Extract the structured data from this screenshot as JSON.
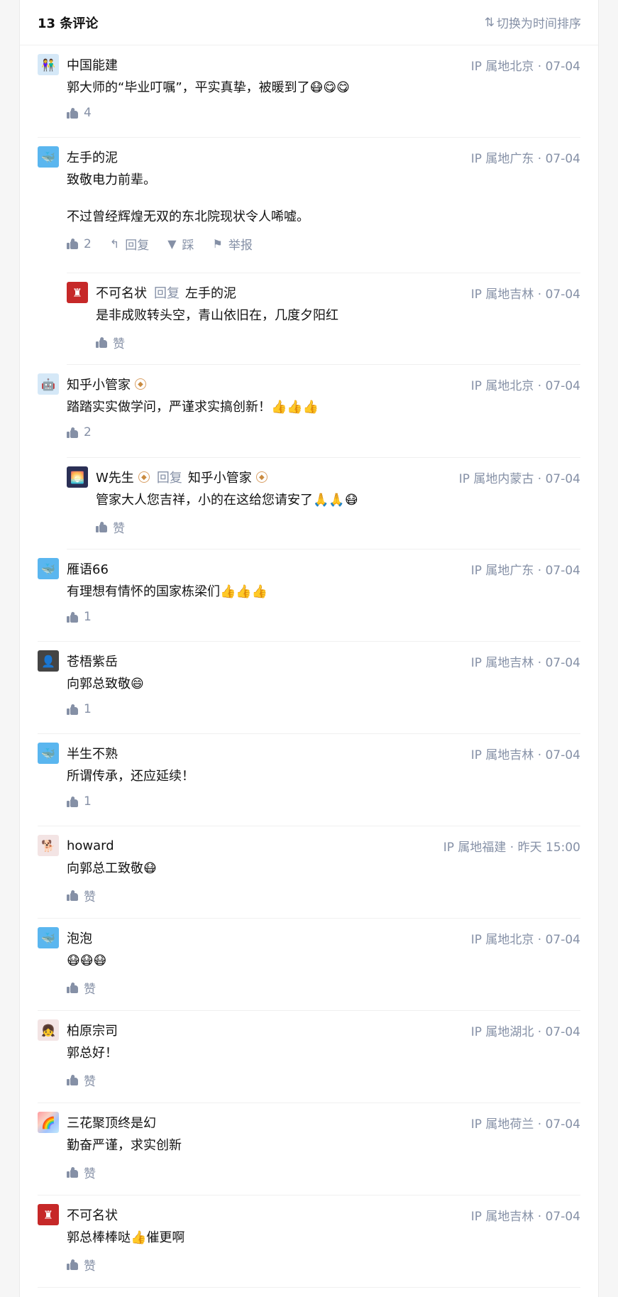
{
  "header": {
    "title": "13 条评论",
    "sort_label": "切换为时间排序",
    "sort_icon": "sort-arrows-icon"
  },
  "labels": {
    "reply": "回复",
    "dislike": "踩",
    "report": "举报",
    "like": "赞",
    "reply_to": "回复"
  },
  "colors": {
    "meta": "#8590a6",
    "text": "#121212",
    "divider": "#f0f0f0"
  },
  "comments": [
    {
      "author": "中国能建",
      "meta": "IP 属地北京 · 07-04",
      "content": "郭大师的“毕业叮嘱”，平实真挚，被暖到了😷😋😋",
      "likes": "4",
      "avatar": "couple-avatar"
    },
    {
      "author": "左手的泥",
      "meta": "IP 属地广东 · 07-04",
      "content_1": "致敬电力前辈。",
      "content_2": "不过曾经辉煌无双的东北院现状令人唏嘘。",
      "likes": "2",
      "avatar": "default-whale-avatar",
      "replies": [
        {
          "author": "不可名状",
          "reply_to": "左手的泥",
          "meta": "IP 属地吉林 · 07-04",
          "content": "是非成败转头空，青山依旧在，几度夕阳红",
          "likes": "赞"
        }
      ]
    },
    {
      "author": "知乎小管家",
      "meta": "IP 属地北京 · 07-04",
      "content": "踏踏实实做学问，严谨求实搞创新！👍👍👍",
      "likes": "2",
      "avatar": "robot-avatar",
      "replies": [
        {
          "author": "W先生",
          "reply_to": "知乎小管家",
          "meta": "IP 属地内蒙古 · 07-04",
          "content": "管家大人您吉祥，小的在这给您请安了🙏🙏😷",
          "likes": "赞"
        }
      ]
    },
    {
      "author": "雁语66",
      "meta": "IP 属地广东 · 07-04",
      "content": "有理想有情怀的国家栋梁们👍👍👍",
      "likes": "1"
    },
    {
      "author": "苍梧紫岳",
      "meta": "IP 属地吉林 · 07-04",
      "content": "向郭总致敬😄",
      "likes": "1"
    },
    {
      "author": "半生不熟",
      "meta": "IP 属地吉林 · 07-04",
      "content": "所谓传承，还应延续！",
      "likes": "1"
    },
    {
      "author": "howard",
      "meta": "IP 属地福建 · 昨天 15:00",
      "content": "向郭总工致敬😷",
      "likes": "赞"
    },
    {
      "author": "泡泡",
      "meta": "IP 属地北京 · 07-04",
      "content": "😷😷😷",
      "likes": "赞"
    },
    {
      "author": "柏原宗司",
      "meta": "IP 属地湖北 · 07-04",
      "content": "郭总好！",
      "likes": "赞"
    },
    {
      "author": "三花聚顶终是幻",
      "meta": "IP 属地荷兰 · 07-04",
      "content": "勤奋严谨，求实创新",
      "likes": "赞"
    },
    {
      "author": "不可名状",
      "meta": "IP 属地吉林 · 07-04",
      "content": "郭总棒棒哒👍催更啊",
      "likes": "赞"
    }
  ]
}
